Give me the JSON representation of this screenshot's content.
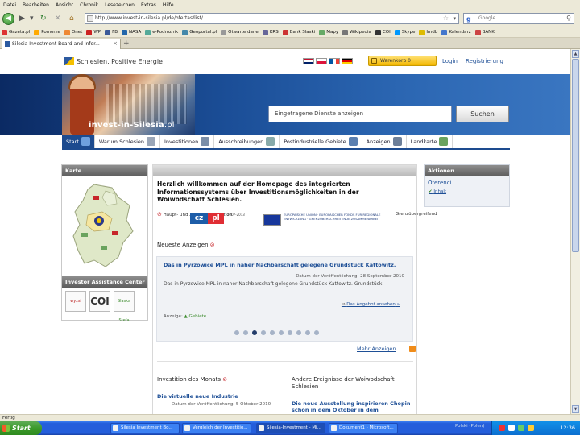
{
  "browser": {
    "menu": [
      "Datei",
      "Bearbeiten",
      "Ansicht",
      "Chronik",
      "Lesezeichen",
      "Extras",
      "Hilfe"
    ],
    "url": "http://www.invest-in-silesia.pl/de/ofertas/list/",
    "search_placeholder": "Google",
    "bookmarks": [
      {
        "label": "Gazeta.pl",
        "color": "#d33"
      },
      {
        "label": "Pomorze",
        "color": "#fa0"
      },
      {
        "label": "Onet",
        "color": "#e83"
      },
      {
        "label": "WP",
        "color": "#c22"
      },
      {
        "label": "FB",
        "color": "#3b5998"
      },
      {
        "label": "NASA",
        "color": "#2266aa"
      },
      {
        "label": "e-Podroznik",
        "color": "#5a9"
      },
      {
        "label": "Geoportal.pl",
        "color": "#48a"
      },
      {
        "label": "Otwarte dane",
        "color": "#999"
      },
      {
        "label": "KRS",
        "color": "#669"
      },
      {
        "label": "Bank Slaski",
        "color": "#c33"
      },
      {
        "label": "Mapy",
        "color": "#6a6"
      },
      {
        "label": "Wikipedia",
        "color": "#777"
      },
      {
        "label": "COI",
        "color": "#333"
      },
      {
        "label": "Skype",
        "color": "#09f"
      },
      {
        "label": "Imdb",
        "color": "#db0"
      },
      {
        "label": "Kalendarz",
        "color": "#47c"
      },
      {
        "label": "BANKI",
        "color": "#c44"
      }
    ],
    "tab_title": "Silesia Investment Board and Infor...",
    "status": "Fertig"
  },
  "header": {
    "logo_text": "Schlesien. Positive Energie",
    "basket_label": "Warenkorb 0",
    "login": "Login",
    "register": "Registrierung"
  },
  "banner": {
    "title_main": "invest-in",
    "title_brand": "Silesia",
    "title_suffix": ".pl",
    "search_placeholder": "Eingetragene Dienste anzeigen",
    "search_button": "Suchen"
  },
  "nav": [
    {
      "label": "Start",
      "active": true,
      "icon_color": "#6fa0dd"
    },
    {
      "label": "Warum Schlesien",
      "active": false,
      "icon_color": "#9aa6b8"
    },
    {
      "label": "Investitionen",
      "active": false,
      "icon_color": "#7b8ea8"
    },
    {
      "label": "Ausschreibungen",
      "active": false,
      "icon_color": "#8aa"
    },
    {
      "label": "Postindustrielle Gebiete",
      "active": false,
      "icon_color": "#5b7fb0"
    },
    {
      "label": "Anzeigen",
      "active": false,
      "icon_color": "#6d7f99"
    },
    {
      "label": "Landkarte",
      "active": false,
      "icon_color": "#6aa35e"
    }
  ],
  "left": {
    "map_title": "Karte",
    "iac_title": "Investor Assistance Center",
    "logos": [
      "wyzsi",
      "COI",
      "Slaska Stefa"
    ]
  },
  "center": {
    "welcome": "Herzlich willkommen auf der Homepage des integrierten Informationssystems über Investitionsmöglichkeiten in der Woiwodschaft Schlesien.",
    "eu_left": "Haupt- und Zukunftsinvestition",
    "czpl": {
      "cz": "cz",
      "pl": "pl",
      "years": "2007-2013"
    },
    "eu_text": "EUROPÄISCHE UNION · EUROPÄISCHER FONDS FÜR REGIONALE ENTWICKLUNG · GRENZÜBERSCHREITENDE ZUSAMMENARBEIT",
    "eu_right": "Grenzübergreifend",
    "ads_heading": "Neueste Anzeigen",
    "ad": {
      "title": "Das in Pyrzowice MPL in naher Nachbarschaft gelegene Grundstück Kattowitz.",
      "date": "Datum der Veröffentlichung: 28 September 2010",
      "desc": "Das in Pyrzowice MPL in naher Nachbarschaft gelegene Grundstück Kattowitz. Grundstück",
      "more": "Das Angebot ansehen",
      "category_label": "Anzeige",
      "category": "Gebiete"
    },
    "dots_total": 10,
    "dots_active": 2,
    "more_ads": "Mehr Anzeigen",
    "invest_heading": "Investition des Monats",
    "invest_title": "Die virtuelle neue Industrie",
    "invest_date": "Datum der Veröffentlichung: 5 Oktober 2010",
    "events_heading": "Andere Ereignisse der Woiwodschaft Schlesien",
    "events_title": "Die neue Ausstellung inspirieren Chopin schon in dem Oktober in dem"
  },
  "right": {
    "title": "Aktionen",
    "action": "Oferenci",
    "link": "Inhalt"
  },
  "taskbar": {
    "start": "Start",
    "tasks": [
      "Silesia Investment Bo...",
      "Vergleich der Investitio...",
      "Silesia-Investment - Mi...",
      "Dokument1 - Microsoft..."
    ],
    "language": "Polski (Polen)",
    "clock": "12:36"
  }
}
